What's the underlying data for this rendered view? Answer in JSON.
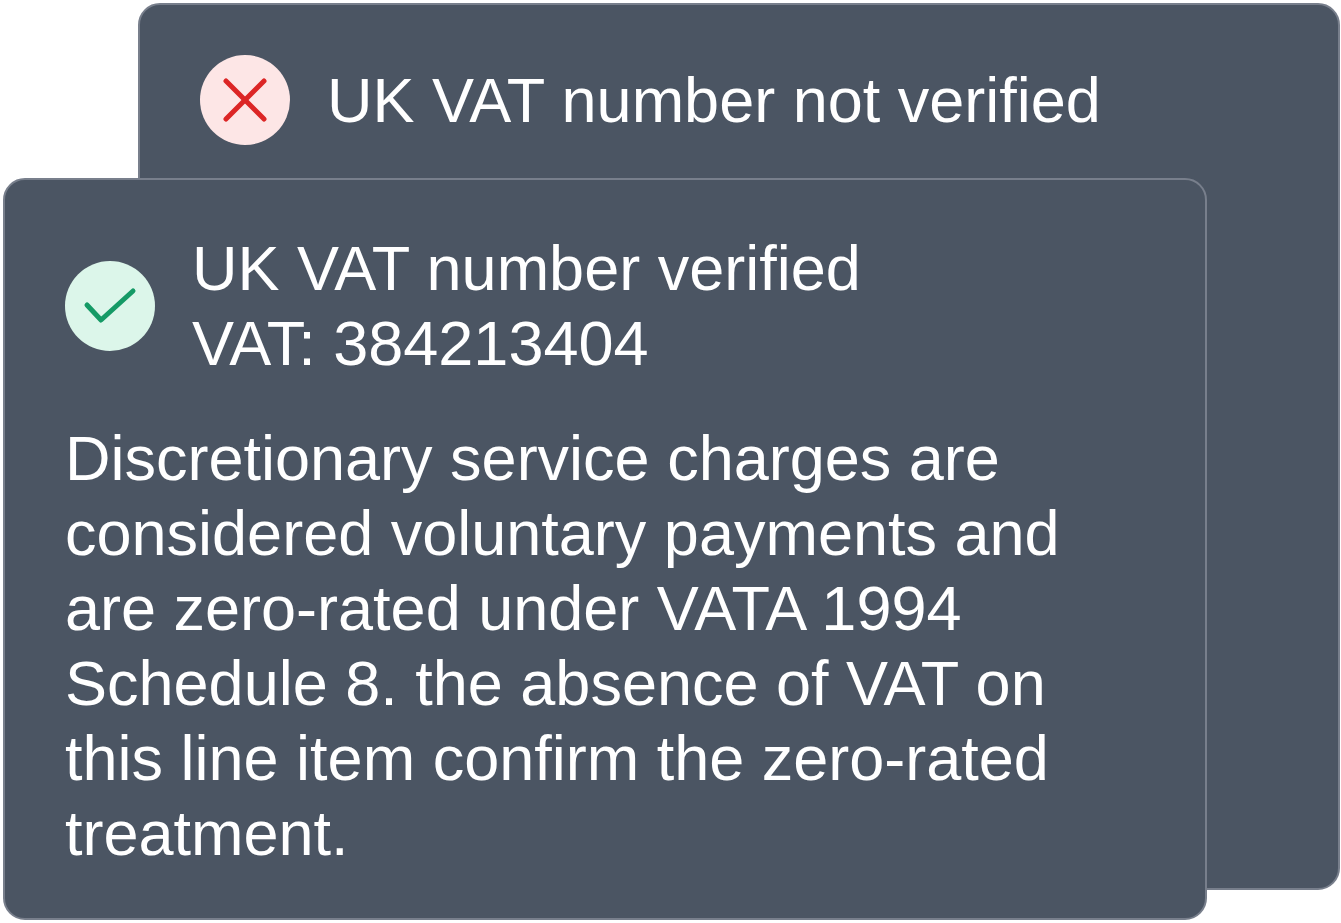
{
  "cards": [
    {
      "kind": "error",
      "title": "UK VAT number not verified"
    },
    {
      "kind": "success",
      "title": "UK VAT number verified",
      "detail": "VAT: 384213404",
      "description": "Discretionary service charges are considered voluntary payments and are zero-rated under VATA 1994 Schedule 8. the absence of VAT on this line item confirm the zero-rated treatment."
    }
  ]
}
